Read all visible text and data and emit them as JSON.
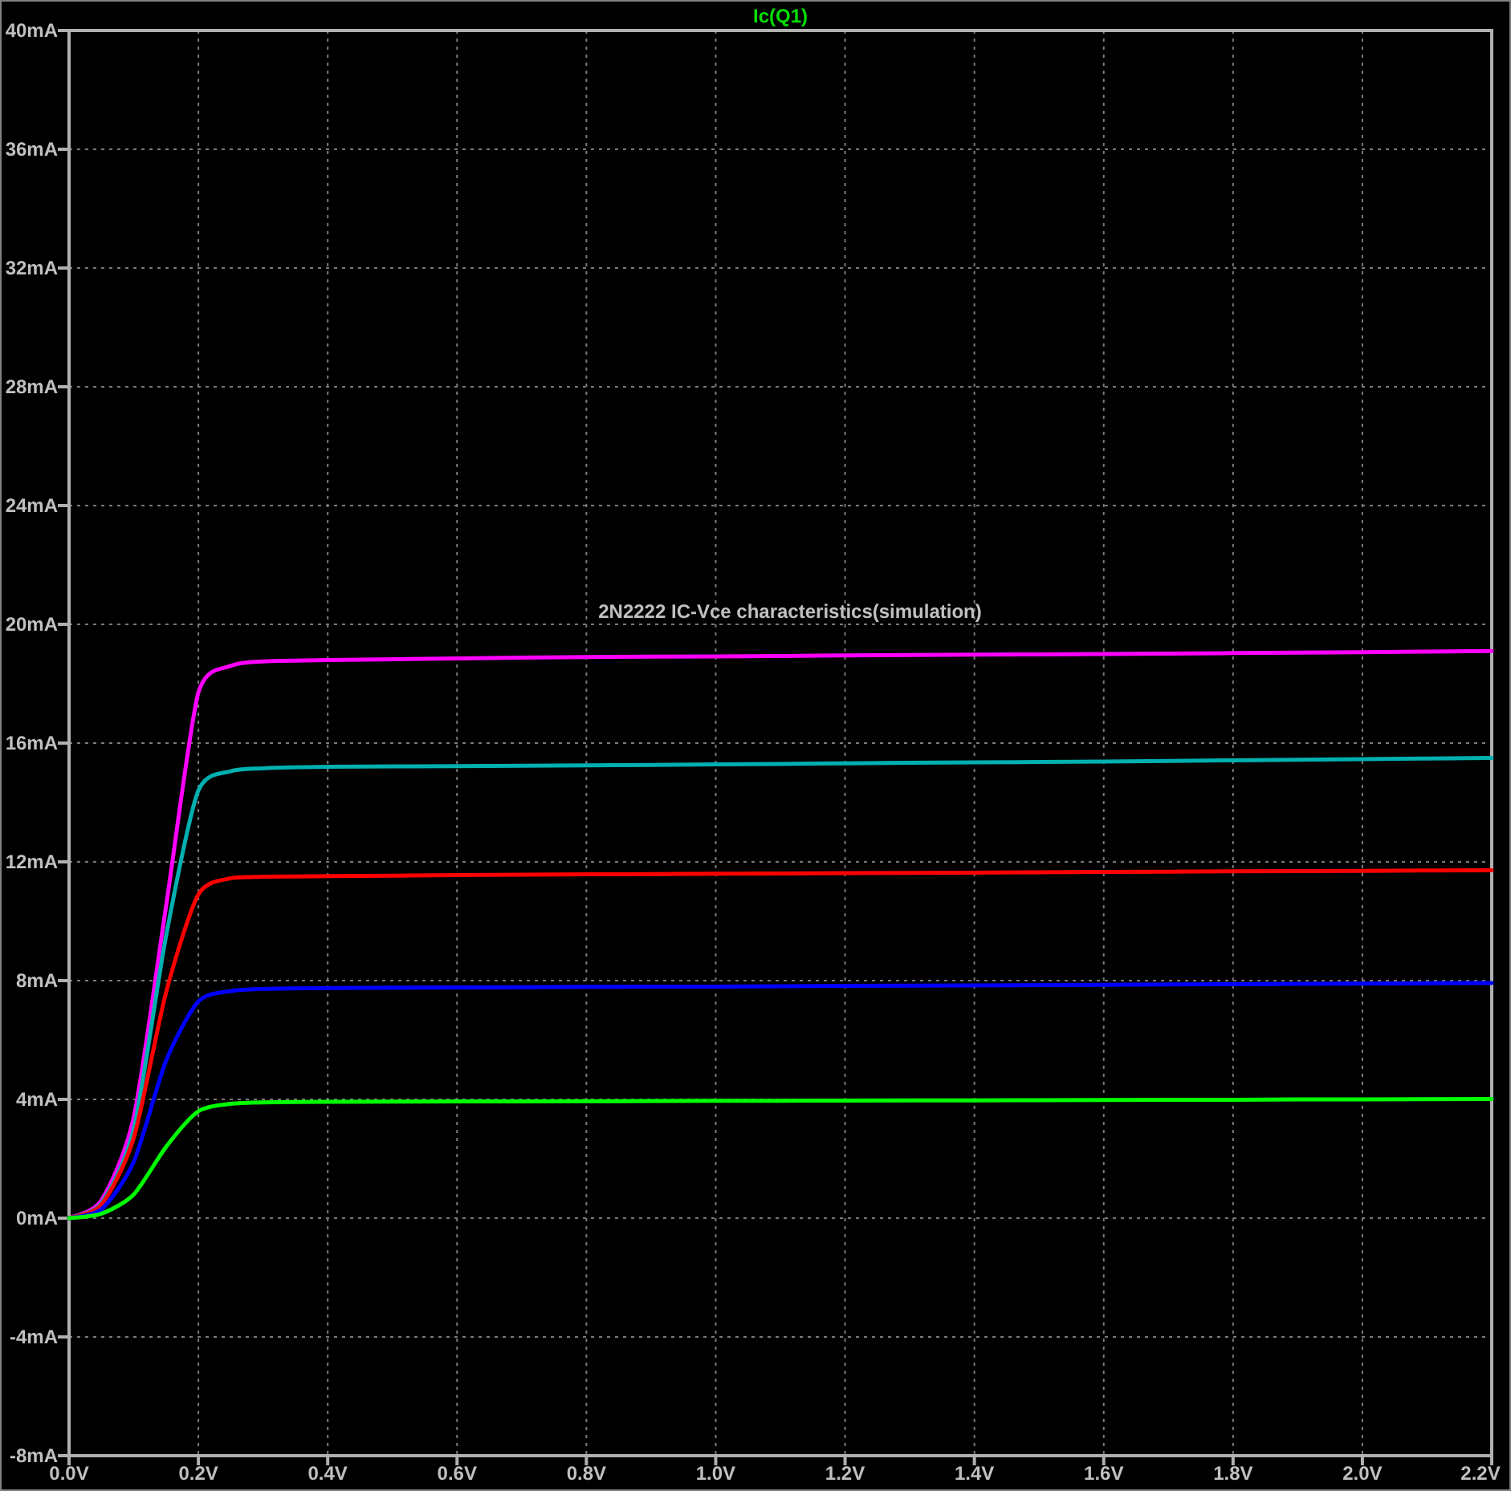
{
  "chart_data": {
    "type": "line",
    "title": "Ic(Q1)",
    "xlim": [
      0,
      2.2
    ],
    "ylim": [
      -8,
      40
    ],
    "x": [
      0,
      0.05,
      0.1,
      0.15,
      0.2,
      0.25,
      0.3,
      0.4,
      0.6,
      0.8,
      1.0,
      1.2,
      1.4,
      1.6,
      1.8,
      2.0,
      2.2
    ],
    "series": [
      {
        "color": "#ff00ff",
        "values": [
          0,
          0.6,
          3.4,
          10.5,
          17.7,
          18.6,
          18.75,
          18.8,
          18.85,
          18.9,
          18.92,
          18.95,
          18.98,
          19.0,
          19.03,
          19.06,
          19.1
        ]
      },
      {
        "color": "#00b0b0",
        "values": [
          0,
          0.5,
          3.0,
          9.5,
          14.4,
          15.05,
          15.15,
          15.2,
          15.22,
          15.25,
          15.28,
          15.32,
          15.35,
          15.38,
          15.42,
          15.46,
          15.5
        ]
      },
      {
        "color": "#ff0000",
        "values": [
          0,
          0.45,
          2.7,
          7.6,
          10.9,
          11.45,
          11.5,
          11.52,
          11.55,
          11.58,
          11.6,
          11.62,
          11.64,
          11.66,
          11.68,
          11.7,
          11.72
        ]
      },
      {
        "color": "#0000ff",
        "values": [
          0,
          0.3,
          1.9,
          5.3,
          7.3,
          7.65,
          7.72,
          7.75,
          7.77,
          7.79,
          7.8,
          7.82,
          7.84,
          7.86,
          7.88,
          7.9,
          7.92
        ]
      },
      {
        "color": "#00ff00",
        "values": [
          0,
          0.15,
          0.8,
          2.4,
          3.6,
          3.85,
          3.9,
          3.92,
          3.93,
          3.94,
          3.95,
          3.96,
          3.97,
          3.98,
          3.99,
          4.0,
          4.01
        ]
      }
    ],
    "xticks": [
      {
        "value": 0,
        "label": "0.0V"
      },
      {
        "value": 0.2,
        "label": "0.2V"
      },
      {
        "value": 0.4,
        "label": "0.4V"
      },
      {
        "value": 0.6,
        "label": "0.6V"
      },
      {
        "value": 0.8,
        "label": "0.8V"
      },
      {
        "value": 1.0,
        "label": "1.0V"
      },
      {
        "value": 1.2,
        "label": "1.2V"
      },
      {
        "value": 1.4,
        "label": "1.4V"
      },
      {
        "value": 1.6,
        "label": "1.6V"
      },
      {
        "value": 1.8,
        "label": "1.8V"
      },
      {
        "value": 2.0,
        "label": "2.0V"
      },
      {
        "value": 2.2,
        "label": "2.2V"
      }
    ],
    "yticks": [
      {
        "value": 40,
        "label": "40mA"
      },
      {
        "value": 36,
        "label": "36mA"
      },
      {
        "value": 32,
        "label": "32mA"
      },
      {
        "value": 28,
        "label": "28mA"
      },
      {
        "value": 24,
        "label": "24mA"
      },
      {
        "value": 20,
        "label": "20mA"
      },
      {
        "value": 16,
        "label": "16mA"
      },
      {
        "value": 12,
        "label": "12mA"
      },
      {
        "value": 8,
        "label": "8mA"
      },
      {
        "value": 4,
        "label": "4mA"
      },
      {
        "value": 0,
        "label": "0mA"
      },
      {
        "value": -4,
        "label": "-4mA"
      },
      {
        "value": -8,
        "label": "-8mA"
      }
    ],
    "grid": true,
    "annotations": [
      "2N2222 IC-Vce characteristics(simulation)"
    ]
  }
}
